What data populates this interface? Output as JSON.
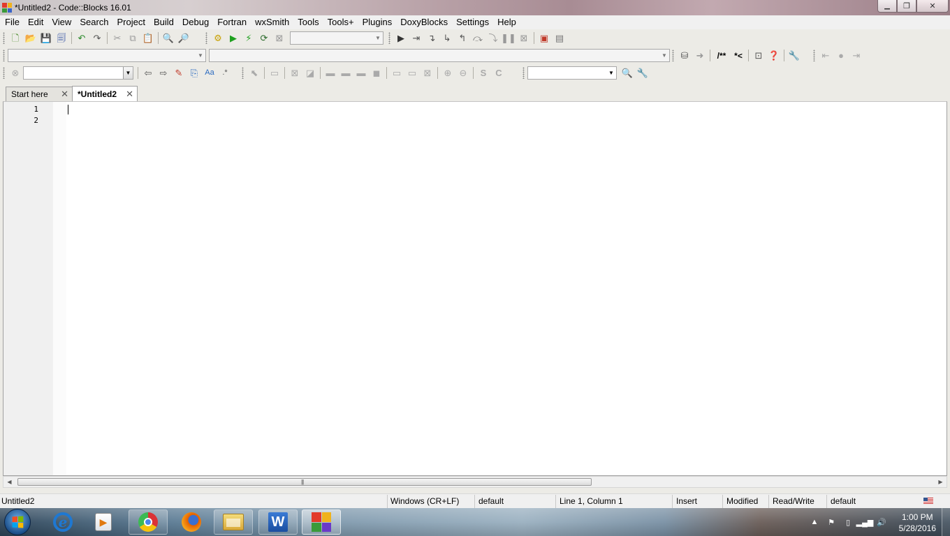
{
  "window": {
    "title": "*Untitled2 - Code::Blocks 16.01",
    "minimize": "▭",
    "maximize": "❐",
    "close": "✕"
  },
  "menu": [
    "File",
    "Edit",
    "View",
    "Search",
    "Project",
    "Build",
    "Debug",
    "Fortran",
    "wxSmith",
    "Tools",
    "Tools+",
    "Plugins",
    "DoxyBlocks",
    "Settings",
    "Help"
  ],
  "toolbar": {
    "doxy_comment_label": "/**",
    "doxy_line_label": "*<"
  },
  "tabs": [
    {
      "label": "Start here",
      "active": false
    },
    {
      "label": "*Untitled2",
      "active": true
    }
  ],
  "editor": {
    "line_numbers": [
      "1",
      "2"
    ]
  },
  "statusbar": {
    "file": "Untitled2",
    "eol": "Windows (CR+LF)",
    "encoding": "default",
    "position": "Line 1, Column 1",
    "mode": "Insert",
    "modified": "Modified",
    "access": "Read/Write",
    "profile": "default"
  },
  "taskbar": {
    "time": "1:00 PM",
    "date": "5/28/2016"
  },
  "colors": {
    "change_marker": "#f3d300",
    "editor_bg": "#ffffff",
    "gutter_bg": "#f0f0f0"
  }
}
